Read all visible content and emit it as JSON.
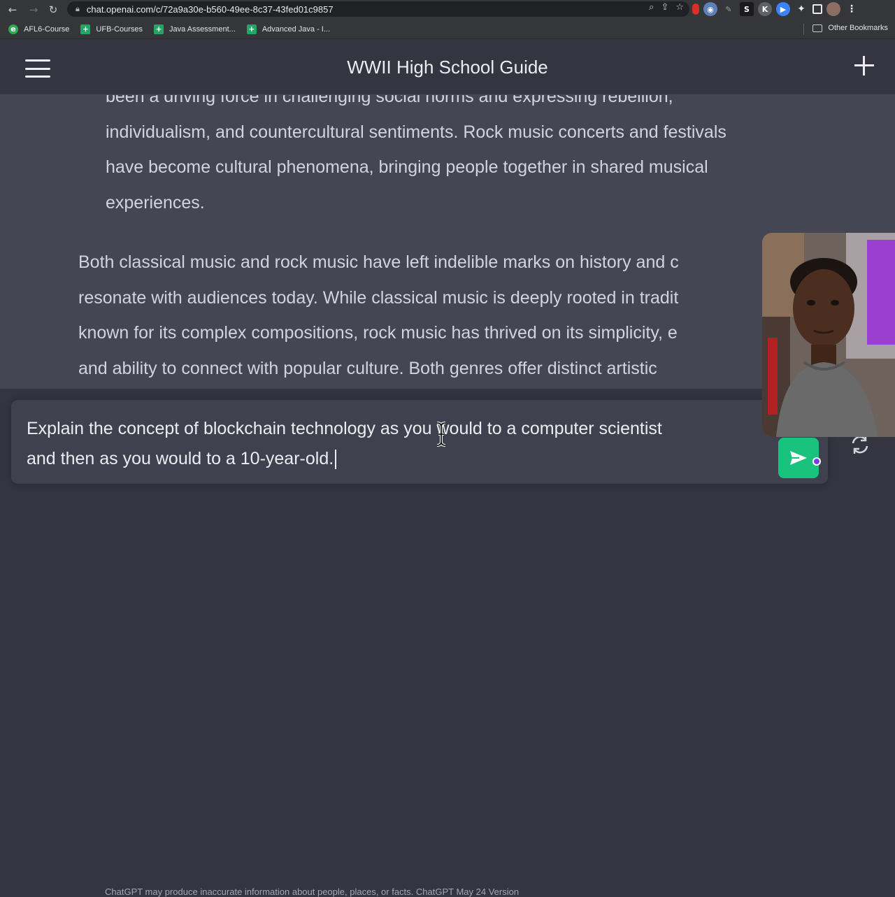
{
  "browser": {
    "url": "chat.openai.com/c/72a9a30e-b560-49ee-8c37-43fed01c9857",
    "bookmarks": [
      {
        "label": "AFL6-Course",
        "icon": "globe-icon",
        "color": "#34a853"
      },
      {
        "label": "UFB-Courses",
        "icon": "sheets-icon",
        "color": "#23a566"
      },
      {
        "label": "Java Assessment...",
        "icon": "sheets-icon",
        "color": "#23a566"
      },
      {
        "label": "Advanced Java - I...",
        "icon": "sheets-icon",
        "color": "#23a566"
      }
    ],
    "other_bookmarks": "Other Bookmarks"
  },
  "header": {
    "title": "WWII High School Guide"
  },
  "conversation": {
    "indented_lines": [
      "been a driving force in challenging social norms and expressing rebellion,",
      "individualism, and countercultural sentiments. Rock music concerts and festivals",
      "have become cultural phenomena, bringing people together in shared musical",
      "experiences."
    ],
    "summary_lines": [
      "Both classical music and rock music have left indelible marks on history and c",
      "resonate with audiences today. While classical music is deeply rooted in tradit",
      "known for its complex compositions, rock music has thrived on its simplicity, e",
      "and ability to connect with popular culture. Both genres offer distinct artistic"
    ]
  },
  "composer": {
    "value_line1": "Explain the concept of blockchain technology as you would to a computer scientist",
    "value_line2": "and then as you would to a 10-year-old."
  },
  "footer": {
    "note": "ChatGPT may produce inaccurate information about people, places, or facts. ChatGPT May 24 Version"
  },
  "colors": {
    "background": "#343541",
    "assistant_bg": "#444654",
    "input_bg": "#40414f",
    "send_button": "#19c37d",
    "text": "#d1d5db"
  }
}
